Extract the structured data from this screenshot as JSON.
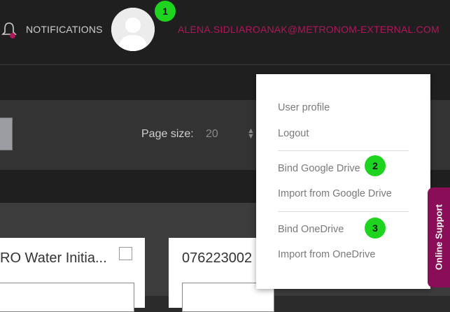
{
  "header": {
    "notifications_label": "NOTIFICATIONS",
    "user_email": "ALENA.SIDLIAROANAK@METRONOM-EXTERNAL.COM",
    "bell_icon": "bell-icon",
    "avatar_icon": "user-avatar-icon"
  },
  "toolbar": {
    "page_size_label": "Page size:",
    "page_size_value": "20"
  },
  "cards": [
    {
      "title": "RO Water Initia..."
    },
    {
      "title": "076223002"
    }
  ],
  "user_menu": {
    "items": [
      {
        "label": "User profile"
      },
      {
        "label": "Logout"
      },
      {
        "label": "Bind Google Drive"
      },
      {
        "label": "Import from Google Drive"
      },
      {
        "label": "Bind OneDrive"
      },
      {
        "label": "Import from OneDrive"
      }
    ]
  },
  "markers": [
    "1",
    "2",
    "3"
  ],
  "support": {
    "label": "Online Support"
  },
  "colors": {
    "accent": "#b0175b",
    "support_bg": "#8a0d58",
    "marker": "#1ed41e"
  }
}
